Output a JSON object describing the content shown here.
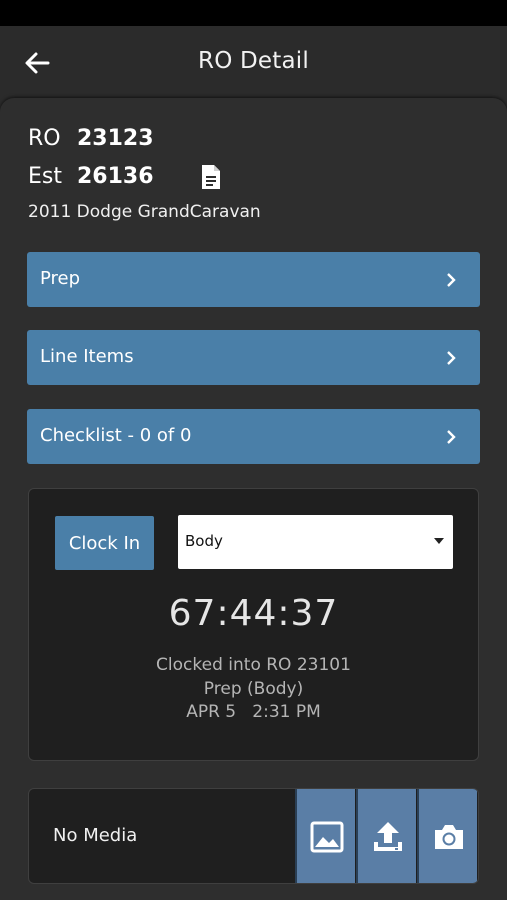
{
  "app_bar": {
    "title": "RO Detail"
  },
  "ro": {
    "ro_label": "RO",
    "ro_number": "23123",
    "est_label": "Est",
    "est_number": "26136",
    "vehicle": "2011 Dodge GrandCaravan"
  },
  "sections": [
    {
      "label": "Prep"
    },
    {
      "label": "Line Items"
    },
    {
      "label": "Checklist - 0 of 0"
    }
  ],
  "clock": {
    "button_label": "Clock In",
    "selected_department": "Body",
    "timer": "67:44:37",
    "status_line_1": "Clocked into RO 23101",
    "status_line_2": "Prep (Body)",
    "status_line_3": "APR 5   2:31 PM"
  },
  "media": {
    "empty_label": "No Media"
  },
  "colors": {
    "accent": "#4a7fa8",
    "media_button": "#5a7ea6",
    "background": "#2b2b2b",
    "card": "#1f1f1f"
  },
  "icons": [
    "back-arrow-icon",
    "document-icon",
    "chevron-right-icon",
    "dropdown-caret-icon",
    "image-icon",
    "upload-icon",
    "camera-icon"
  ]
}
